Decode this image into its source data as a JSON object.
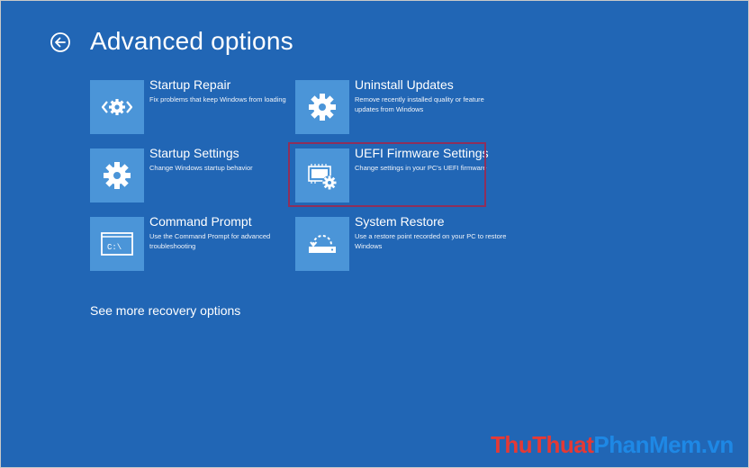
{
  "header": {
    "title": "Advanced options",
    "back_icon": "back-arrow-circle-icon"
  },
  "tiles": [
    {
      "title": "Startup Repair",
      "desc": "Fix problems that keep Windows from loading",
      "icon": "startup-repair-icon"
    },
    {
      "title": "Uninstall Updates",
      "desc": "Remove recently installed quality or feature updates from Windows",
      "icon": "gear-icon"
    },
    {
      "title": "Startup Settings",
      "desc": "Change Windows startup behavior",
      "icon": "gear-icon"
    },
    {
      "title": "UEFI Firmware Settings",
      "desc": "Change settings in your PC's UEFI firmware",
      "icon": "firmware-chip-gear-icon"
    },
    {
      "title": "Command Prompt",
      "desc": "Use the Command Prompt for advanced troubleshooting",
      "icon": "command-prompt-icon",
      "icon_text": "C:\\"
    },
    {
      "title": "System Restore",
      "desc": "Use a restore point recorded on your PC to restore Windows",
      "icon": "system-restore-icon"
    }
  ],
  "more_link": "See more recovery options",
  "watermark": {
    "part1": "ThuThuat",
    "part2": "PhanMem",
    "part3": ".vn"
  },
  "colors": {
    "background": "#2166B5",
    "tile_icon_bg": "#4B95D8",
    "highlight_border": "#8E2F5B"
  }
}
